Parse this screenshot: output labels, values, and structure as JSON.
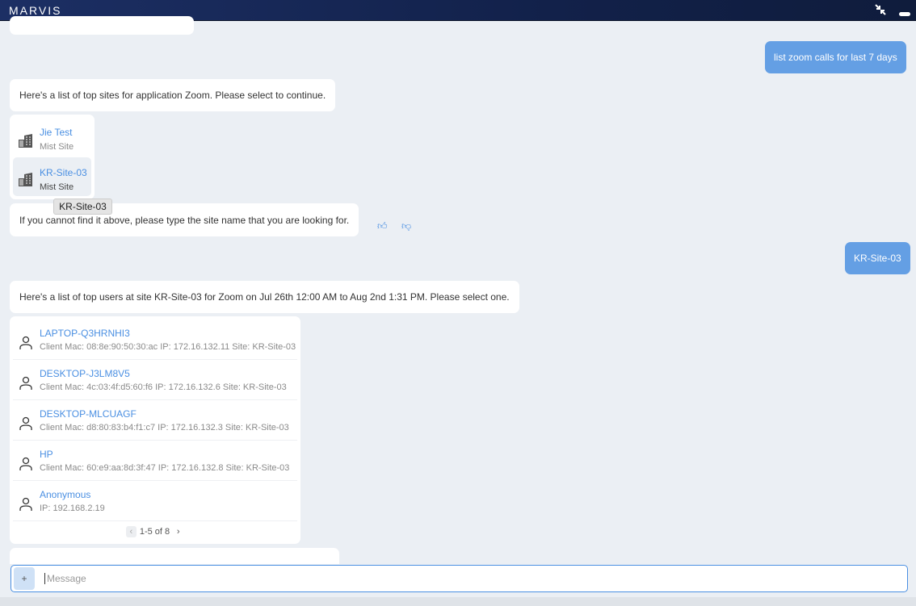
{
  "header": {
    "title": "MARVIS",
    "collapse_icon": "collapse-arrows-icon",
    "minimize_icon": "minimize-icon"
  },
  "messages": {
    "user1": "list zoom calls for last 7 days",
    "bot1": "Here's a list of top sites for application Zoom. Please select to continue.",
    "sites": [
      {
        "name": "Jie Test",
        "type": "Mist Site"
      },
      {
        "name": "KR-Site-03",
        "type": "Mist Site"
      }
    ],
    "tooltip": "KR-Site-03",
    "bot2": "If you cannot find it above, please type the site name that you are looking for.",
    "user2": "KR-Site-03",
    "bot3": "Here's a list of top users at site KR-Site-03 for Zoom on Jul 26th 12:00 AM to Aug 2nd 1:31 PM. Please select one.",
    "users": [
      {
        "name": "LAPTOP-Q3HRNHI3",
        "detail": "Client Mac: 08:8e:90:50:30:ac IP: 172.16.132.11 Site: KR-Site-03"
      },
      {
        "name": "DESKTOP-J3LM8V5",
        "detail": "Client Mac: 4c:03:4f:d5:60:f6 IP: 172.16.132.6 Site: KR-Site-03"
      },
      {
        "name": "DESKTOP-MLCUAGF",
        "detail": "Client Mac: d8:80:83:b4:f1:c7 IP: 172.16.132.3 Site: KR-Site-03"
      },
      {
        "name": "HP",
        "detail": "Client Mac: 60:e9:aa:8d:3f:47 IP: 172.16.132.8 Site: KR-Site-03"
      },
      {
        "name": "Anonymous",
        "detail": "IP: 192.168.2.19"
      }
    ],
    "pagination": "1-5 of 8"
  },
  "input": {
    "placeholder": "Message",
    "add_label": "+"
  },
  "colors": {
    "accent": "#4a8fe2",
    "user_bubble": "#649fe4",
    "header": "#1c2f64"
  }
}
